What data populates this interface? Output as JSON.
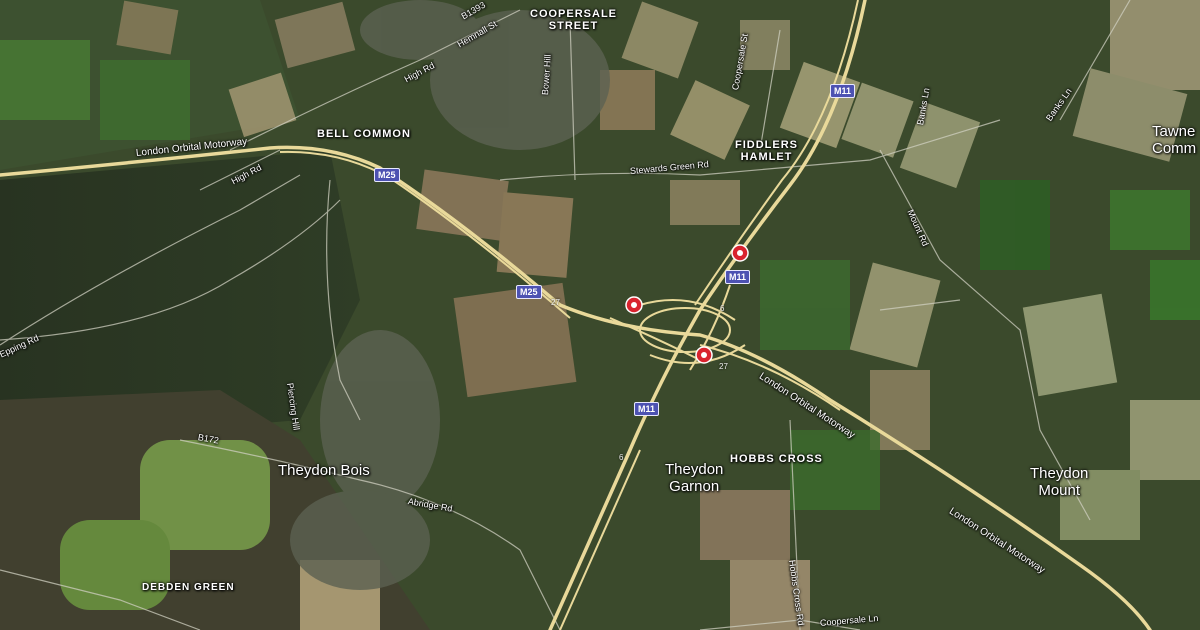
{
  "places": {
    "coopersale_street": "COOPERSALE\nSTREET",
    "bell_common": "BELL COMMON",
    "fiddlers_hamlet": "FIDDLERS\nHAMLET",
    "hobbs_cross": "HOBBS CROSS",
    "debden_green": "DEBDEN GREEN",
    "theydon_bois": "Theydon Bois",
    "theydon_garnon": "Theydon\nGarnon",
    "theydon_mount": "Theydon\nMount",
    "tawney_common": "Tawne\nComm"
  },
  "roads": {
    "b1393": "B1393",
    "hemnall_st": "Hemnall St",
    "high_rd_north": "High Rd",
    "high_rd_west": "High Rd",
    "london_orbital_west": "London Orbital Motorway",
    "london_orbital_east1": "London Orbital Motorway",
    "london_orbital_east2": "London Orbital Motorway",
    "stewards_green_rd": "Stewards Green Rd",
    "bower_hill": "Bower Hill",
    "coopersale_st": "Coopersale St",
    "banks_ln_1": "Banks Ln",
    "banks_ln_2": "Banks Ln",
    "mount_rd": "Mount Rd",
    "epping_rd": "Epping Rd",
    "piercing_hill": "Piercing Hill",
    "b172": "B172",
    "abridge_rd": "Abridge Rd",
    "hobbs_cross_rd": "Hobbs Cross Rd",
    "coopersale_ln": "Coopersale Ln",
    "epping_rd_south": "Epping Rd"
  },
  "shields": {
    "m25_a": "M25",
    "m25_b": "M25",
    "m11_a": "M11",
    "m11_b": "M11",
    "m11_c": "M11"
  },
  "junctions": {
    "j27_a": "27",
    "j27_b": "27",
    "j6_a": "6",
    "j6_b": "6"
  },
  "markers": [
    "location-pin",
    "location-pin",
    "location-pin"
  ],
  "colors": {
    "motorway": "#e9d99a",
    "shield": "#4d52b2",
    "pin": "#d9232e"
  }
}
